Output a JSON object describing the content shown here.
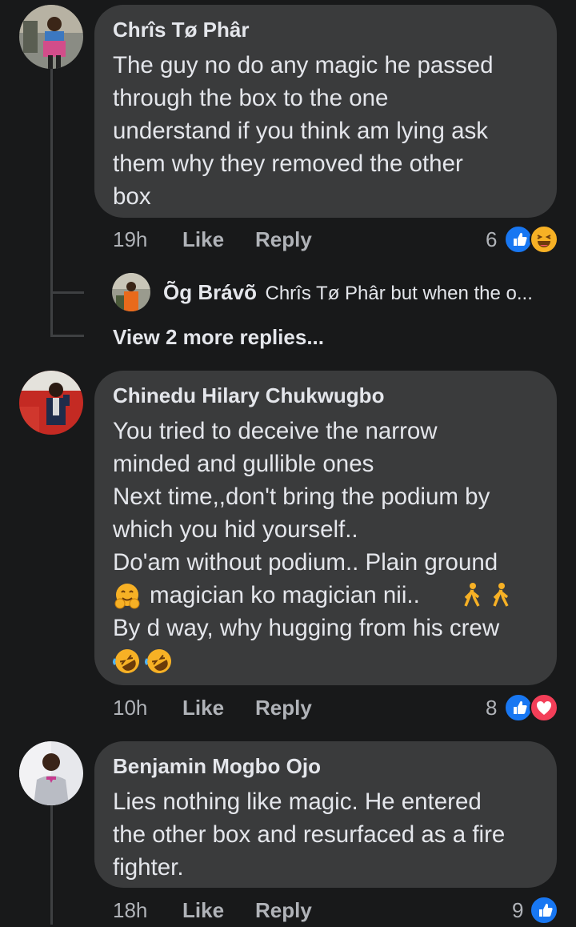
{
  "comments": [
    {
      "author": "Chrîs Tø Phâr",
      "lines": [
        "The guy no do any magic he passed",
        "through the box to the one",
        "understand if you think am lying ask",
        "them why they removed the other",
        "box"
      ],
      "time": "19h",
      "like_label": "Like",
      "reply_label": "Reply",
      "reaction_count": "6",
      "reactions": [
        "like-icon",
        "haha-icon"
      ],
      "reply_preview": {
        "author": "Õg Brávõ",
        "text": "Chrîs Tø Phâr but when the o..."
      },
      "view_more": "View 2 more replies..."
    },
    {
      "author": "Chinedu Hilary Chukwugbo",
      "lines": [
        "You tried to deceive the narrow",
        "minded and gullible ones",
        "Next time,,don't bring the podium by",
        "which you hid yourself..",
        "Do'am without podium.. Plain ground",
        " magician ko magician nii..  ",
        "By d way, why hugging from his crew",
        ""
      ],
      "time": "10h",
      "like_label": "Like",
      "reply_label": "Reply",
      "reaction_count": "8",
      "reactions": [
        "like-icon",
        "love-icon"
      ]
    },
    {
      "author": "Benjamin Mogbo Ojo",
      "lines": [
        "Lies nothing like magic. He entered",
        "the other box and resurfaced as a fire",
        "fighter."
      ],
      "time": "18h",
      "like_label": "Like",
      "reply_label": "Reply",
      "reaction_count": "9",
      "reactions": [
        "like-icon"
      ]
    }
  ],
  "colors": {
    "background": "#18191a",
    "bubble": "#3a3b3c",
    "text": "#e4e6eb",
    "secondary_text": "#b0b3b8",
    "like_blue": "#1877f2",
    "love_red": "#f33e58",
    "haha_yellow": "#f7b125"
  }
}
